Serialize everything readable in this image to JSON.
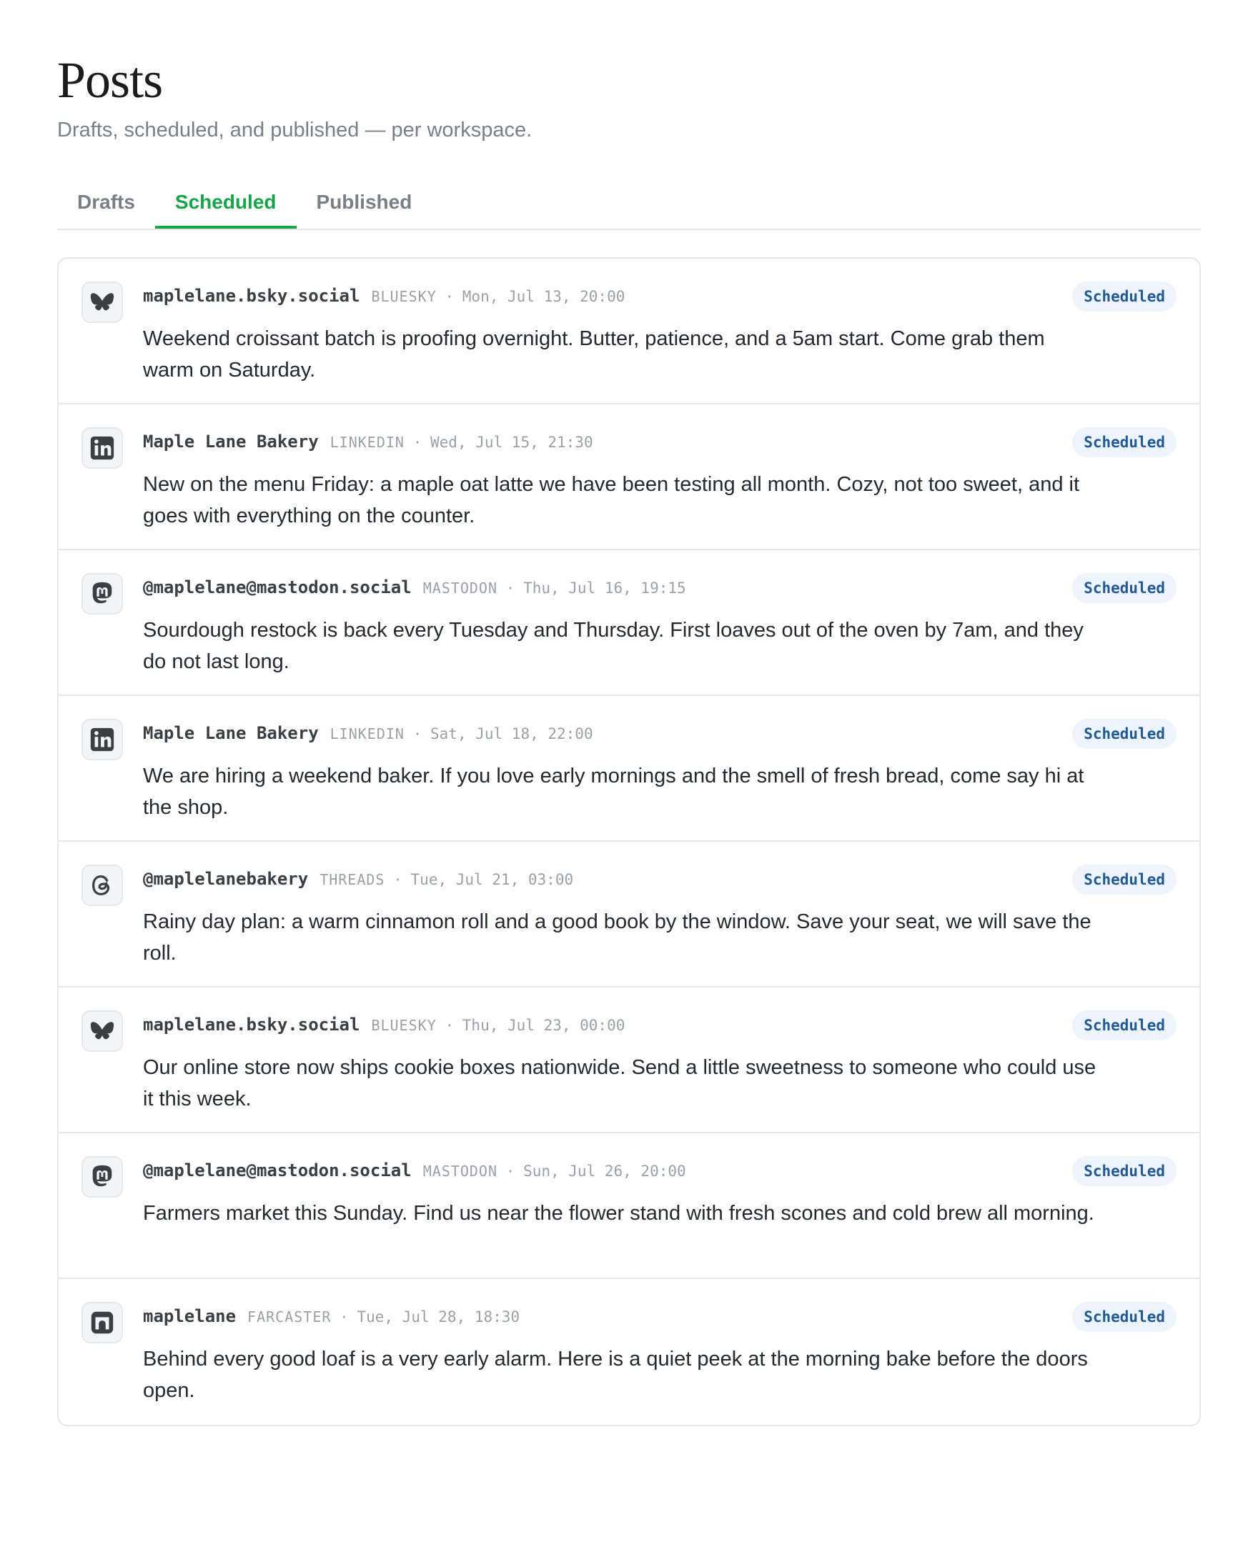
{
  "header": {
    "title": "Posts",
    "subtitle": "Drafts, scheduled, and published — per workspace."
  },
  "tabs": [
    {
      "label": "Drafts",
      "active": false
    },
    {
      "label": "Scheduled",
      "active": true
    },
    {
      "label": "Published",
      "active": false
    }
  ],
  "colors": {
    "accent": "#16a34a",
    "badge_bg": "#eef4fb",
    "badge_text": "#1f5a96"
  },
  "posts": [
    {
      "icon": "bluesky-icon",
      "handle": "maplelane.bsky.social",
      "platform": "BLUESKY",
      "separator": "·",
      "when": "Mon, Jul 13, 20:00",
      "text": "Weekend croissant batch is proofing overnight. Butter, patience, and a 5am start. Come grab them warm on Saturday.",
      "status": "Scheduled"
    },
    {
      "icon": "linkedin-icon",
      "handle": "Maple Lane Bakery",
      "platform": "LINKEDIN",
      "separator": "·",
      "when": "Wed, Jul 15, 21:30",
      "text": "New on the menu Friday: a maple oat latte we have been testing all month. Cozy, not too sweet, and it goes with everything on the counter.",
      "status": "Scheduled"
    },
    {
      "icon": "mastodon-icon",
      "handle": "@maplelane@mastodon.social",
      "platform": "MASTODON",
      "separator": "·",
      "when": "Thu, Jul 16, 19:15",
      "text": "Sourdough restock is back every Tuesday and Thursday. First loaves out of the oven by 7am, and they do not last long.",
      "status": "Scheduled"
    },
    {
      "icon": "linkedin-icon",
      "handle": "Maple Lane Bakery",
      "platform": "LINKEDIN",
      "separator": "·",
      "when": "Sat, Jul 18, 22:00",
      "text": "We are hiring a weekend baker. If you love early mornings and the smell of fresh bread, come say hi at the shop.",
      "status": "Scheduled"
    },
    {
      "icon": "threads-icon",
      "handle": "@maplelanebakery",
      "platform": "THREADS",
      "separator": "·",
      "when": "Tue, Jul 21, 03:00",
      "text": "Rainy day plan: a warm cinnamon roll and a good book by the window. Save your seat, we will save the roll.",
      "status": "Scheduled"
    },
    {
      "icon": "bluesky-icon",
      "handle": "maplelane.bsky.social",
      "platform": "BLUESKY",
      "separator": "·",
      "when": "Thu, Jul 23, 00:00",
      "text": "Our online store now ships cookie boxes nationwide. Send a little sweetness to someone who could use it this week.",
      "status": "Scheduled"
    },
    {
      "icon": "mastodon-icon",
      "handle": "@maplelane@mastodon.social",
      "platform": "MASTODON",
      "separator": "·",
      "when": "Sun, Jul 26, 20:00",
      "text": "Farmers market this Sunday. Find us near the flower stand with fresh scones and cold brew all morning.",
      "status": "Scheduled"
    },
    {
      "icon": "farcaster-icon",
      "handle": "maplelane",
      "platform": "FARCASTER",
      "separator": "·",
      "when": "Tue, Jul 28, 18:30",
      "text": "Behind every good loaf is a very early alarm. Here is a quiet peek at the morning bake before the doors open.",
      "status": "Scheduled"
    }
  ]
}
